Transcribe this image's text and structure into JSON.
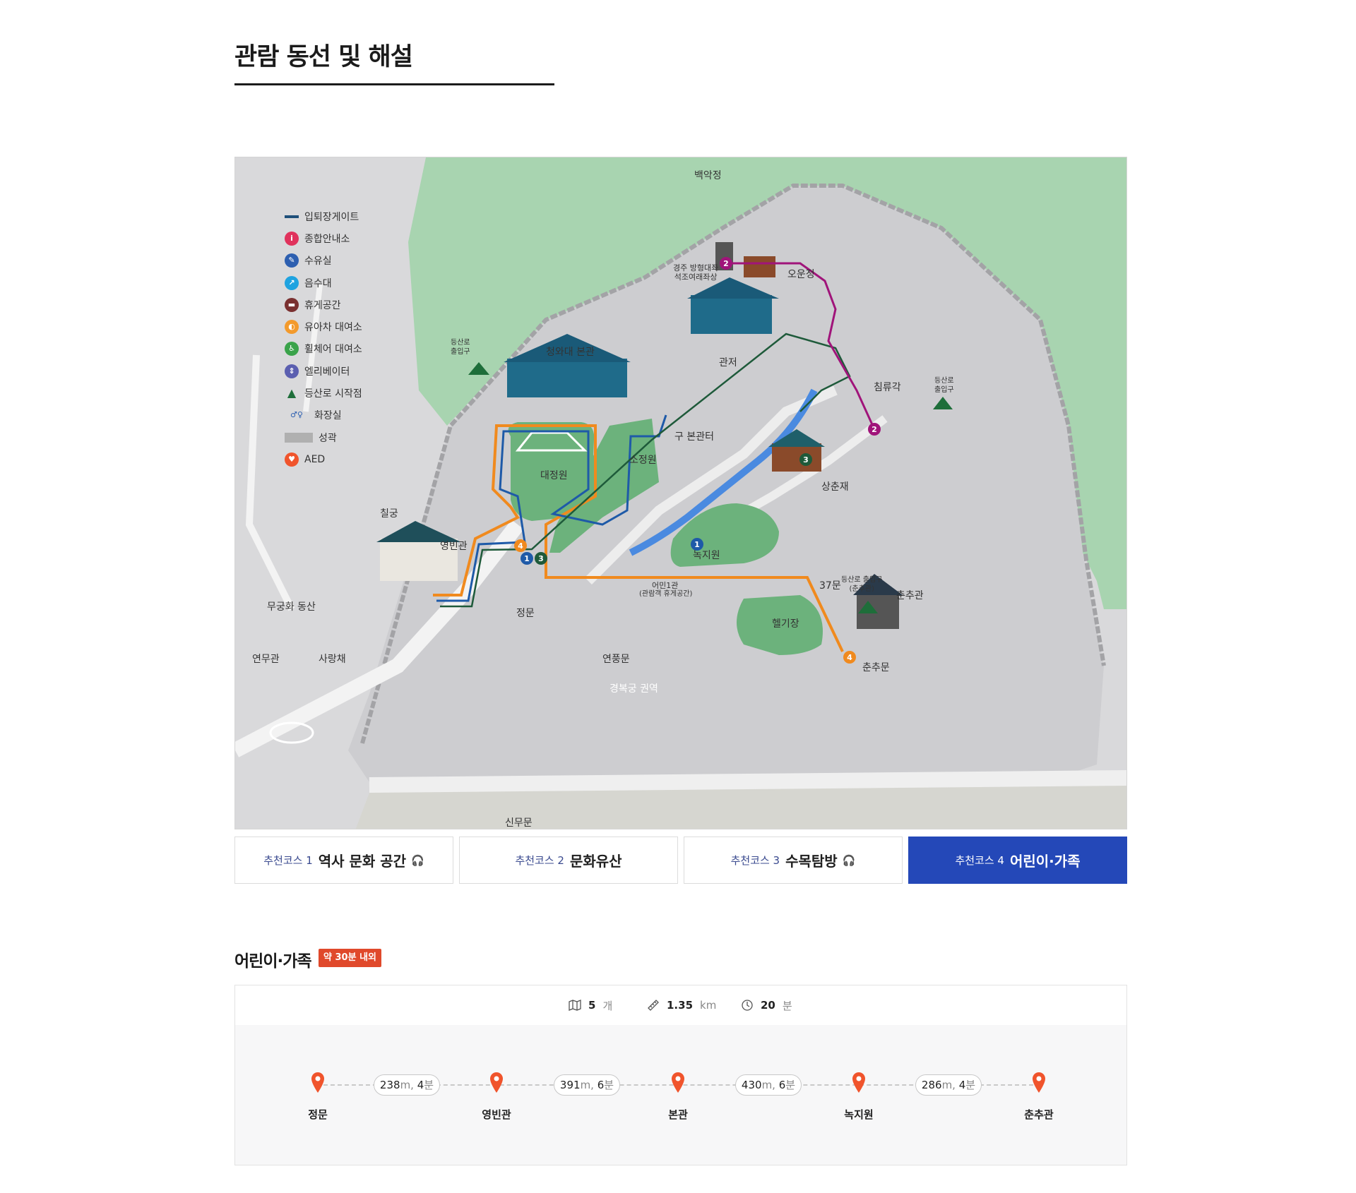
{
  "page": {
    "title": "관람 동선 및 해설"
  },
  "map": {
    "legend": [
      {
        "label": "입퇴장게이트",
        "icon": "gate-line-icon",
        "color": "#1e4f7a"
      },
      {
        "label": "종합안내소",
        "icon": "info-icon",
        "color": "#e0325c"
      },
      {
        "label": "수유실",
        "icon": "nursing-room-icon",
        "color": "#2d5fb0"
      },
      {
        "label": "음수대",
        "icon": "drinking-fountain-icon",
        "color": "#1fa3e0"
      },
      {
        "label": "휴게공간",
        "icon": "rest-area-icon",
        "color": "#7a3030"
      },
      {
        "label": "유아차 대여소",
        "icon": "stroller-rental-icon",
        "color": "#f39a2c"
      },
      {
        "label": "휠체어 대여소",
        "icon": "wheelchair-rental-icon",
        "color": "#3aa34a"
      },
      {
        "label": "엘리베이터",
        "icon": "elevator-icon",
        "color": "#5b5fb0"
      },
      {
        "label": "등산로 시작점",
        "icon": "trailhead-icon",
        "color": "#1e6e3a"
      },
      {
        "label": "화장실",
        "icon": "restroom-icon",
        "color": "#2d5fb0"
      },
      {
        "label": "성곽",
        "icon": "fortress-wall-icon",
        "color": "#b0b0b0"
      },
      {
        "label": "AED",
        "icon": "aed-icon",
        "color": "#f0542c"
      }
    ],
    "places": {
      "baegakjeong": "백악정",
      "buddha": "경주 방형대좌\n석조여래좌상",
      "oun": "오운정",
      "gwanjeo": "관저",
      "main": "청와대 본관",
      "old_main": "구 본관터",
      "sojeong": "소정원",
      "daejeong": "대정원",
      "chilgung": "칠궁",
      "yeongbin": "영빈관",
      "mugunghwa": "무궁화 동산",
      "yeonmu": "연무관",
      "sarang": "사랑채",
      "jeongmun": "정문",
      "sinmu": "신무문",
      "yeonpung": "연풍문",
      "eomin": "어민1관",
      "eomin_sub": "(관람객 휴게공간)",
      "nokji": "녹지원",
      "sangchun": "상춘재",
      "chimnyu": "침류각",
      "gate37": "37문",
      "heli": "헬기장",
      "chunchu_gwan": "춘추관",
      "chunchu_mun": "춘추문",
      "gyeongbok": "경복궁 권역",
      "trail_left": "등산로\n출입구",
      "trail_right": "등산로\n출입구",
      "trail_bottom": "등산로 출입구\n(춘추관)"
    },
    "route_colors": {
      "course1": "#1e5aa8",
      "course2": "#a0147a",
      "course3": "#1e5a3a",
      "course4": "#f08a1e"
    }
  },
  "tabs": [
    {
      "num": "추천코스 1",
      "name": "역사 문화 공간",
      "audio": true,
      "active": false
    },
    {
      "num": "추천코스 2",
      "name": "문화유산",
      "audio": false,
      "active": false
    },
    {
      "num": "추천코스 3",
      "name": "수목탐방",
      "audio": true,
      "active": false
    },
    {
      "num": "추천코스 4",
      "name": "어린이·가족",
      "audio": false,
      "active": true
    }
  ],
  "course": {
    "title": "어린이·가족",
    "badge": "약 30분 내외",
    "stats": {
      "spots": "5",
      "spots_unit": "개",
      "distance": "1.35",
      "distance_unit": "km",
      "time": "20",
      "time_unit": "분"
    },
    "stops": [
      "정문",
      "영빈관",
      "본관",
      "녹지원",
      "춘추관"
    ],
    "segments": [
      {
        "m": "238",
        "min": "4"
      },
      {
        "m": "391",
        "min": "6"
      },
      {
        "m": "430",
        "min": "6"
      },
      {
        "m": "286",
        "min": "4"
      }
    ]
  }
}
